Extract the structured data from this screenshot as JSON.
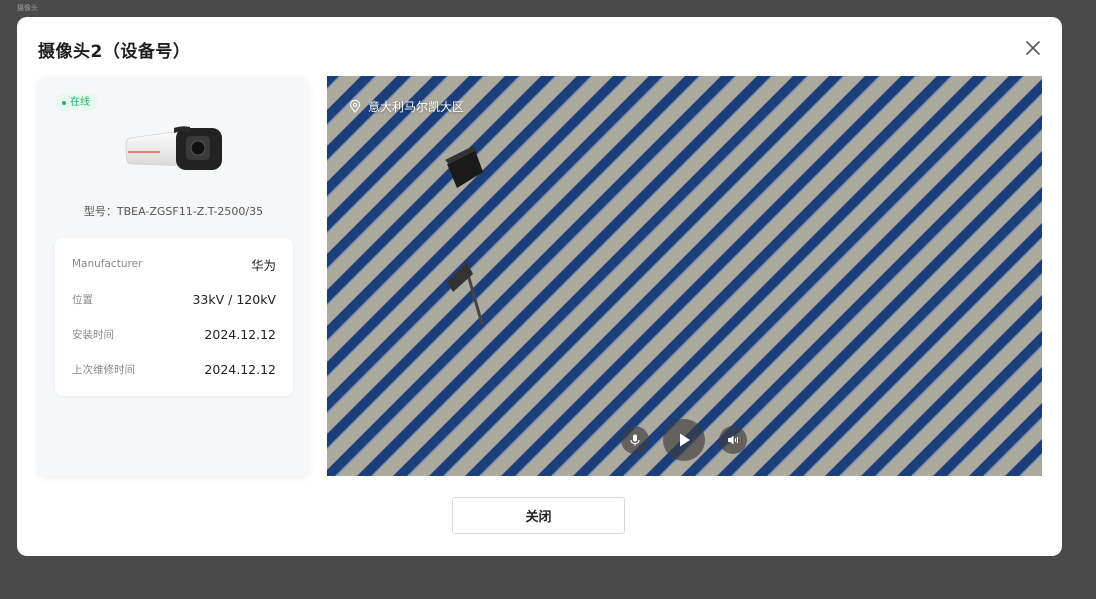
{
  "page": {
    "label": "摄像头"
  },
  "modal": {
    "title": "摄像头2（设备号）",
    "close_button_label": "关闭"
  },
  "device": {
    "status": "在线",
    "model_text": "型号：TBEA-ZGSF11-Z.T-2500/35",
    "info": [
      {
        "key": "Manufacturer",
        "value": "华为"
      },
      {
        "key": "位置",
        "value": "33kV / 120kV"
      },
      {
        "key": "安装时间",
        "value": "2024.12.12"
      },
      {
        "key": "上次维修时间",
        "value": "2024.12.12"
      }
    ]
  },
  "video": {
    "location": "意大利马尔凯大区",
    "controls": [
      "microphone-icon",
      "play-icon",
      "volume-icon"
    ]
  },
  "colors": {
    "online_green": "#29b36d",
    "panel_blue": "#1c3f7c",
    "ground": "#a9a69b"
  }
}
